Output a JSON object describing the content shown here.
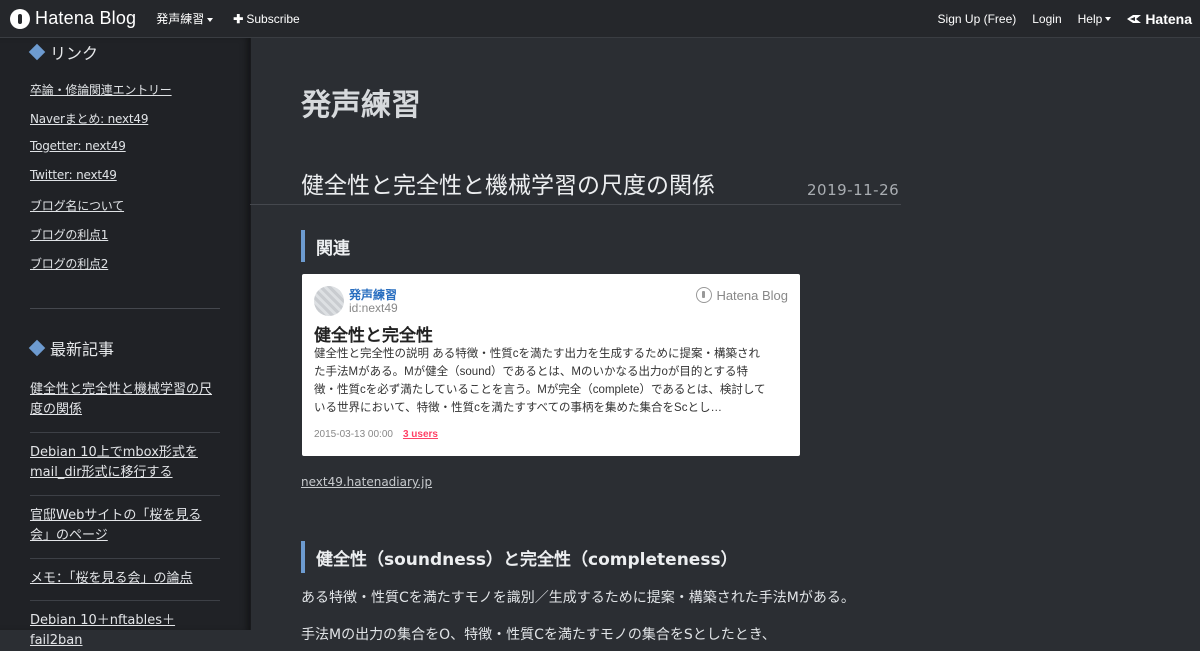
{
  "topbar": {
    "brand": "Hatena Blog",
    "blog_menu": "発声練習",
    "subscribe": "Subscribe",
    "signup": "Sign Up (Free)",
    "login": "Login",
    "help": "Help",
    "hatena": "Hatena"
  },
  "sidebar": {
    "links_title": "リンク",
    "links": [
      "卒論・修論関連エントリー",
      "Naverまとめ: next49",
      "Togetter: next49",
      "Twitter: next49",
      "ブログ名について",
      "ブログの利点1",
      "ブログの利点2"
    ],
    "recent_title": "最新記事",
    "recent": [
      "健全性と完全性と機械学習の尺度の関係",
      "Debian 10上でmbox形式をmail_dir形式に移行する",
      "官邸Webサイトの「桜を見る会」のページ",
      "メモ：「桜を見る会」の論点",
      "Debian 10＋nftables＋fail2ban"
    ]
  },
  "main": {
    "blog_title": "発声練習",
    "entry_title": "健全性と完全性と機械学習の尺度の関係",
    "entry_date": "2019-11-26",
    "section1": "関連",
    "card": {
      "blog_name": "発声練習",
      "user_id": "id:next49",
      "logo": "Hatena Blog",
      "title": "健全性と完全性",
      "desc_lines": [
        "健全性と完全性の説明 ある特徴・性質cを満たす出力を生成するために提案・構築され",
        "た手法Mがある。Mが健全（sound）であるとは、Mのいかなる出力oが目的とする特",
        "徴・性質cを必ず満たしていることを言う。Mが完全（complete）であるとは、検討して",
        "いる世界において、特徴・性質cを満たすすべての事柄を集めた集合をScとし…"
      ],
      "date": "2015-03-13 00:00",
      "users": "3 users"
    },
    "source_link": "next49.hatenadiary.jp",
    "section2": "健全性（soundness）と完全性（completeness）",
    "para1": "ある特徴・性質Cを満たすモノを識別／生成するために提案・構築された手法Mがある。",
    "para2": "手法Mの出力の集合をO、特徴・性質Cを満たすモノの集合をSとしたとき、"
  },
  "colors": {
    "accent": "#6d9bd0",
    "users": "#ff4166"
  }
}
